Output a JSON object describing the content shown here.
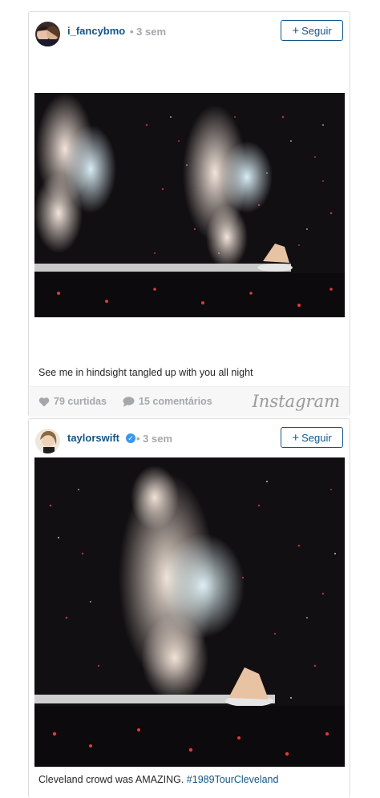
{
  "posts": [
    {
      "username": "i_fancybmo",
      "time": "• 3 sem",
      "follow_label": "Seguir",
      "caption": "See me in hindsight tangled up with you all night",
      "likes": "79 curtidas",
      "comments": "15 comentários",
      "brand": "Instagram"
    },
    {
      "username": "taylorswift",
      "time": "• 3 sem",
      "follow_label": "Seguir",
      "caption": "Cleveland crowd was AMAZING. ",
      "hashtag": "#1989TourCleveland"
    }
  ],
  "colors": {
    "link": "#125688",
    "muted": "#a5a7aa",
    "verified": "#3897f0"
  },
  "icons": [
    "plus-icon",
    "heart-icon",
    "comment-icon",
    "verified-badge-icon"
  ]
}
